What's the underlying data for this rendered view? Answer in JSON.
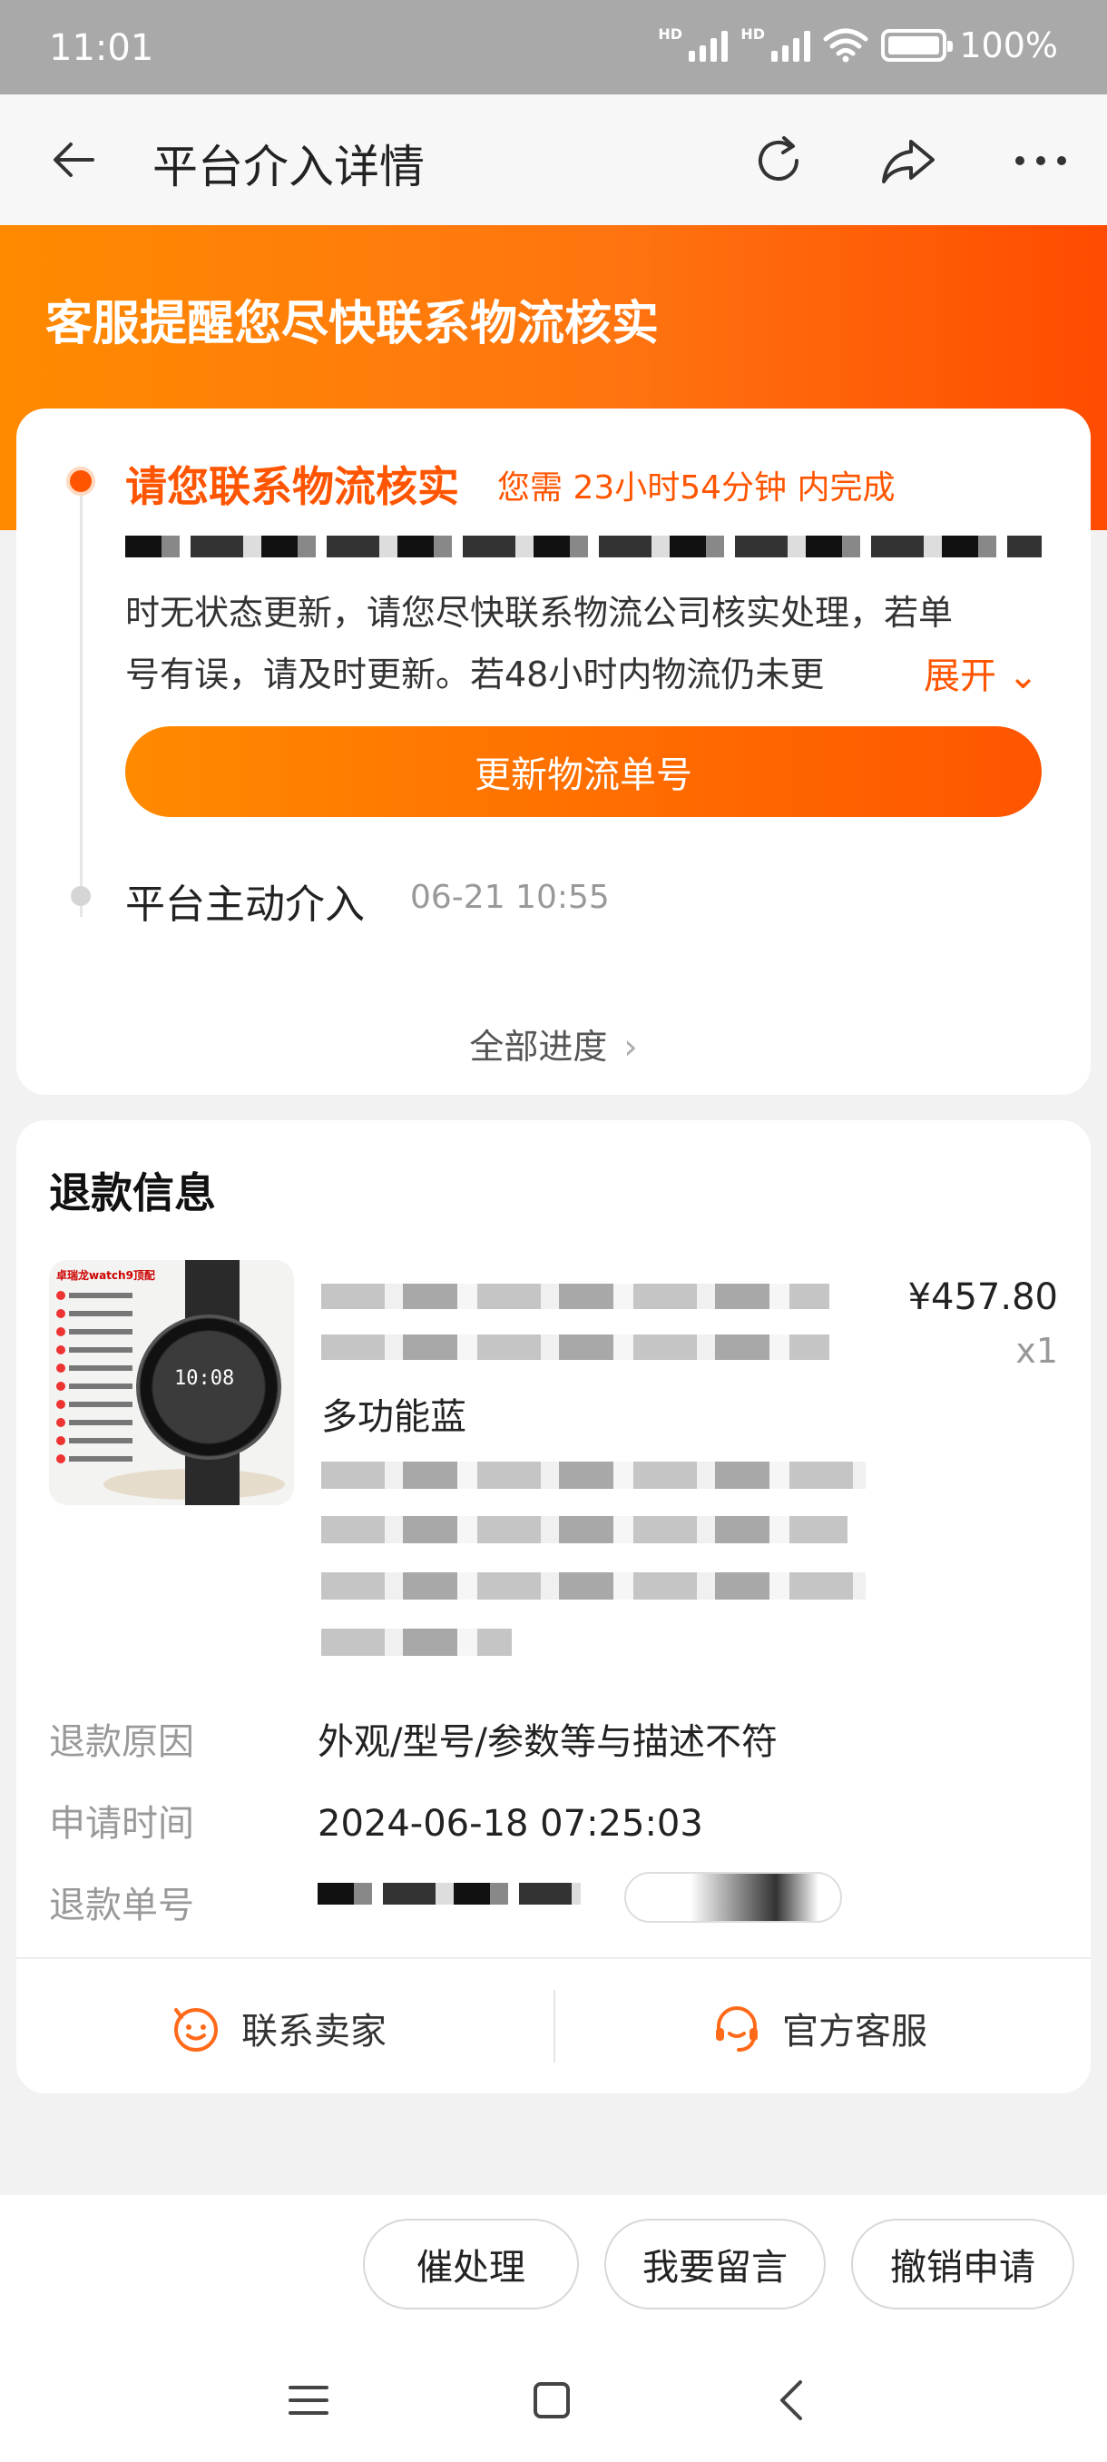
{
  "status_bar": {
    "time": "11:01",
    "battery": "100%",
    "hd1": "HD",
    "hd2": "HD"
  },
  "header": {
    "title": "平台介入详情"
  },
  "banner": {
    "text": "客服提醒您尽快联系物流核实"
  },
  "progress": {
    "step1_title": "请您联系物流核实",
    "step1_deadline": "您需 23小时54分钟 内完成",
    "desc_line1": "时无状态更新，请您尽快联系物流公司核实处理，若单",
    "desc_line2": "号有误，请及时更新。若48小时内物流仍未更",
    "expand_label": "展开",
    "update_button": "更新物流单号",
    "step2_title": "平台主动介入",
    "step2_time": "06-21 10:55",
    "all_progress": "全部进度"
  },
  "refund": {
    "section_title": "退款信息",
    "price": "¥457.80",
    "quantity": "x1",
    "variant": "多功能蓝",
    "thumb_header": "卓瑞龙watch9顶配",
    "thumb_face_time": "10:08",
    "rows": [
      {
        "label": "退款原因",
        "value": "外观/型号/参数等与描述不符"
      },
      {
        "label": "申请时间",
        "value": "2024-06-18 07:25:03"
      },
      {
        "label": "退款单号",
        "value": ""
      }
    ],
    "contact_seller": "联系卖家",
    "official_service": "官方客服"
  },
  "bottom_actions": {
    "urge": "催处理",
    "message": "我要留言",
    "cancel": "撤销申请"
  },
  "colors": {
    "accent": "#ff5500",
    "banner_start": "#ff8a00",
    "banner_end": "#ff4b00"
  }
}
